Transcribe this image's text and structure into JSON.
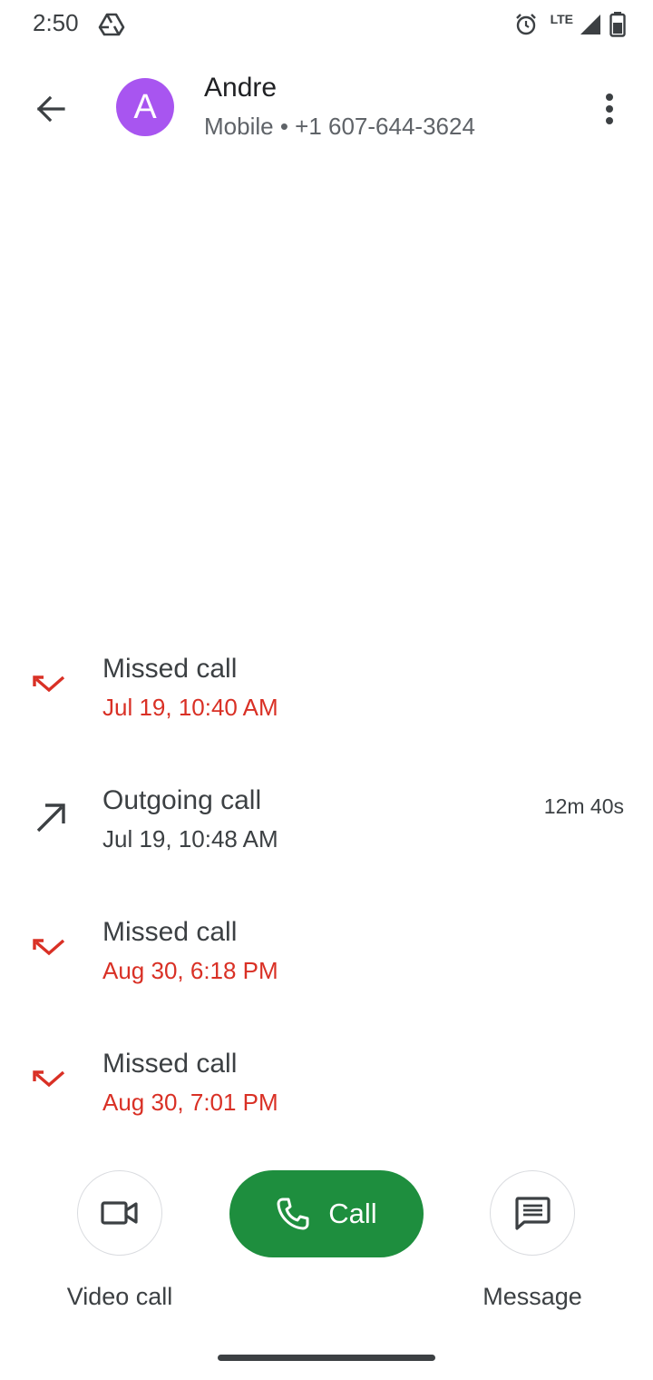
{
  "status_bar": {
    "time": "2:50",
    "network_label": "LTE",
    "icons": [
      "drive-icon",
      "alarm-icon",
      "signal-icon",
      "battery-icon"
    ]
  },
  "contact": {
    "avatar_letter": "A",
    "avatar_color": "#a855f0",
    "name": "Andre",
    "subtitle": "Mobile • +1 607-644-3624"
  },
  "calls": [
    {
      "type": "missed",
      "title": "Missed call",
      "time": "Jul 19, 10:40 AM",
      "duration": ""
    },
    {
      "type": "outgoing",
      "title": "Outgoing call",
      "time": "Jul 19, 10:48 AM",
      "duration": "12m 40s"
    },
    {
      "type": "missed",
      "title": "Missed call",
      "time": "Aug 30, 6:18 PM",
      "duration": ""
    },
    {
      "type": "missed",
      "title": "Missed call",
      "time": "Aug 30, 7:01 PM",
      "duration": ""
    }
  ],
  "actions": {
    "video_label": "Video call",
    "call_label": "Call",
    "message_label": "Message"
  },
  "colors": {
    "missed": "#d93025",
    "call_button": "#1e8e3e",
    "text_primary": "#202124",
    "text_secondary": "#5f6368"
  }
}
